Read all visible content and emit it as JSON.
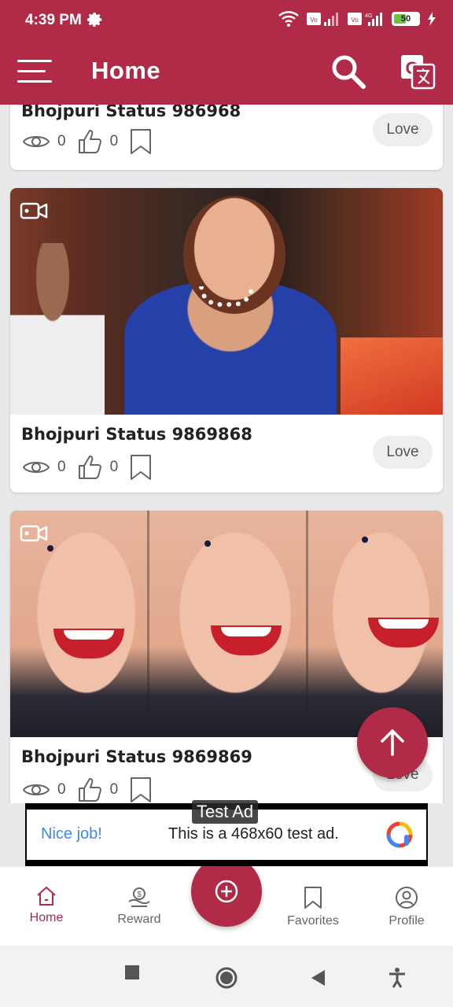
{
  "status_bar": {
    "time": "4:39 PM",
    "battery": "50"
  },
  "app_bar": {
    "title": "Home"
  },
  "cards": [
    {
      "title": "Bhojpuri Status 986968",
      "views": "0",
      "likes": "0",
      "love_label": "Love"
    },
    {
      "title": "Bhojpuri Status 9869868",
      "views": "0",
      "likes": "0",
      "love_label": "Love"
    },
    {
      "title": "Bhojpuri Status 9869869",
      "views": "0",
      "likes": "0",
      "love_label": "Love"
    }
  ],
  "ad": {
    "tag": "Test Ad",
    "headline": "Nice job!",
    "text": "This is a 468x60 test ad."
  },
  "bottom_nav": {
    "home": "Home",
    "reward": "Reward",
    "favorites": "Favorites",
    "profile": "Profile"
  },
  "colors": {
    "primary": "#b12a48",
    "ad_blue": "#4285f4"
  }
}
